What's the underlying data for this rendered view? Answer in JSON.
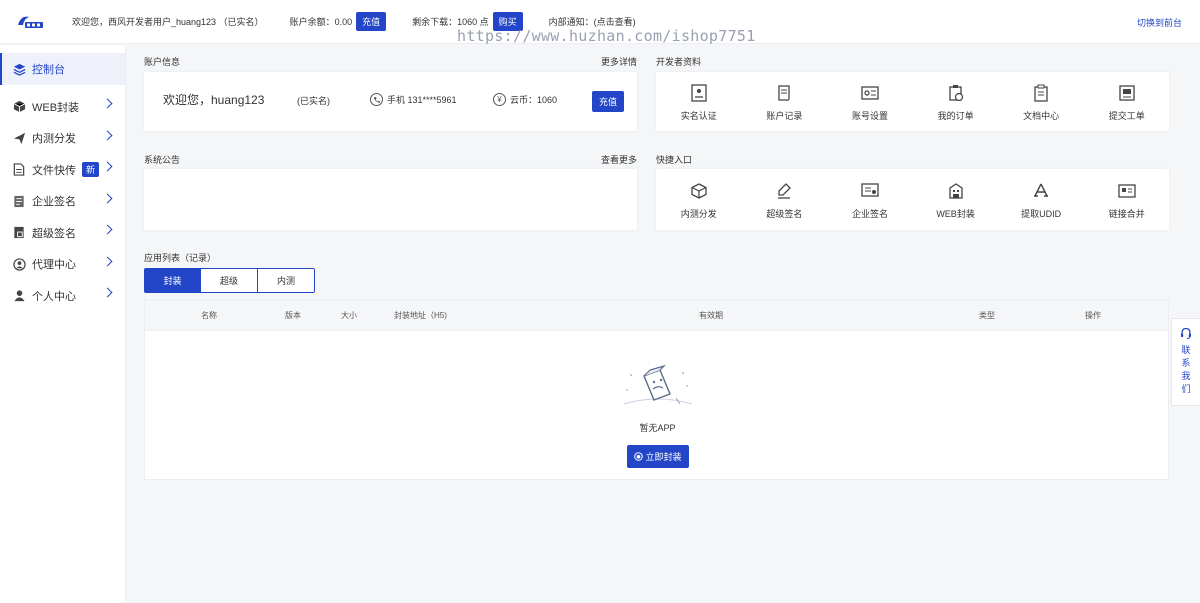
{
  "topbar": {
    "welcome": "欢迎您，西风开发者用户_huang123 （已实名）",
    "balance_label": "账户余额：0.00",
    "recharge_label": "充值",
    "downloads_label": "剩余下载：1060 点",
    "buy_label": "购买",
    "notice_label": "内部通知：(点击查看)",
    "switch_label": "切换到前台"
  },
  "watermark": "https://www.huzhan.com/ishop7751",
  "sidebar": {
    "items": [
      {
        "label": "控制台",
        "icon": "layers-icon"
      },
      {
        "label": "WEB封装",
        "icon": "cube-icon"
      },
      {
        "label": "内测分发",
        "icon": "paper-plane-icon"
      },
      {
        "label": "文件快传",
        "icon": "file-icon",
        "badge": "新"
      },
      {
        "label": "企业签名",
        "icon": "document-icon"
      },
      {
        "label": "超级签名",
        "icon": "doc-stamp-icon"
      },
      {
        "label": "代理中心",
        "icon": "agent-icon"
      },
      {
        "label": "个人中心",
        "icon": "user-icon"
      }
    ]
  },
  "account": {
    "title": "账户信息",
    "more": "更多详情",
    "greeting": "欢迎您，huang123",
    "verified": "(已实名)",
    "phone": "手机 131****5961",
    "coins": "云币：1060",
    "recharge": "充值"
  },
  "developer": {
    "title": "开发者资料",
    "items": [
      {
        "label": "实名认证",
        "icon": "id-card-icon"
      },
      {
        "label": "账户记录",
        "icon": "scroll-icon"
      },
      {
        "label": "账号设置",
        "icon": "settings-card-icon"
      },
      {
        "label": "我的订单",
        "icon": "clipboard-clock-icon"
      },
      {
        "label": "文档中心",
        "icon": "clipboard-icon"
      },
      {
        "label": "提交工单",
        "icon": "ticket-icon"
      }
    ]
  },
  "notice": {
    "title": "系统公告",
    "more": "查看更多"
  },
  "quick": {
    "title": "快捷入口",
    "items": [
      {
        "label": "内测分发",
        "icon": "box-icon"
      },
      {
        "label": "超级签名",
        "icon": "pen-icon"
      },
      {
        "label": "企业签名",
        "icon": "certificate-icon"
      },
      {
        "label": "WEB封装",
        "icon": "building-icon"
      },
      {
        "label": "提取UDID",
        "icon": "app-store-icon"
      },
      {
        "label": "链接合并",
        "icon": "link-merge-icon"
      }
    ]
  },
  "apps": {
    "title": "应用列表（记录）",
    "tabs": [
      "封装",
      "超级",
      "内测"
    ],
    "active_tab": 0,
    "columns": [
      "名称",
      "版本",
      "大小",
      "封装地址（H5)",
      "有效期",
      "类型",
      "操作"
    ],
    "empty": "暂无APP",
    "create_button": "立即封装"
  },
  "contact": {
    "label": "联系我们",
    "chars": [
      "联",
      "系",
      "我",
      "们"
    ]
  },
  "colors": {
    "accent": "#2346c8",
    "background": "#f5f6f8"
  }
}
